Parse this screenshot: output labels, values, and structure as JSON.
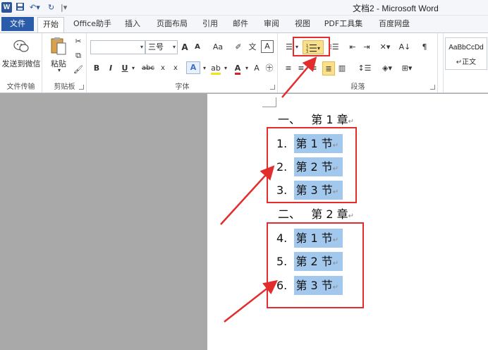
{
  "window": {
    "title": "文档2 - Microsoft Word",
    "app_icon": "W",
    "quick_access": [
      "save-icon",
      "undo-icon",
      "redo-icon",
      "customize-icon"
    ]
  },
  "tabs": {
    "file": "文件",
    "items": [
      "开始",
      "Office助手",
      "插入",
      "页面布局",
      "引用",
      "邮件",
      "审阅",
      "视图",
      "PDF工具集",
      "百度网盘"
    ],
    "active": "开始"
  },
  "ribbon": {
    "groups": {
      "send": "文件传输",
      "clipboard": "剪贴板",
      "font": "字体",
      "paragraph": "段落"
    },
    "send_label": "发送到微信",
    "paste_label": "粘贴",
    "font_name": "",
    "font_size": "三号",
    "grow": "A",
    "shrink": "A",
    "case": "Aa",
    "bold": "B",
    "italic": "I",
    "underline": "U",
    "strike": "abc",
    "sub": "x",
    "sup": "x",
    "highlight": "A",
    "fontcolor": "A",
    "style_preview": "AaBbCcDd",
    "style_name": "↵正文"
  },
  "document": {
    "chapters": [
      {
        "prefix": "一、",
        "title": "第 1 章",
        "sections": [
          {
            "num": "1.",
            "text": "第 1 节"
          },
          {
            "num": "2.",
            "text": "第 2 节"
          },
          {
            "num": "3.",
            "text": "第 3 节"
          }
        ]
      },
      {
        "prefix": "二、",
        "title": "第 2 章",
        "sections": [
          {
            "num": "4.",
            "text": "第 1 节"
          },
          {
            "num": "5.",
            "text": "第 2 节"
          },
          {
            "num": "6.",
            "text": "第 3 节"
          }
        ]
      }
    ],
    "para_mark": "↵"
  },
  "colors": {
    "annotation_red": "#e32d2d",
    "selection": "#a3c8ee",
    "file_tab": "#2a5caa"
  }
}
